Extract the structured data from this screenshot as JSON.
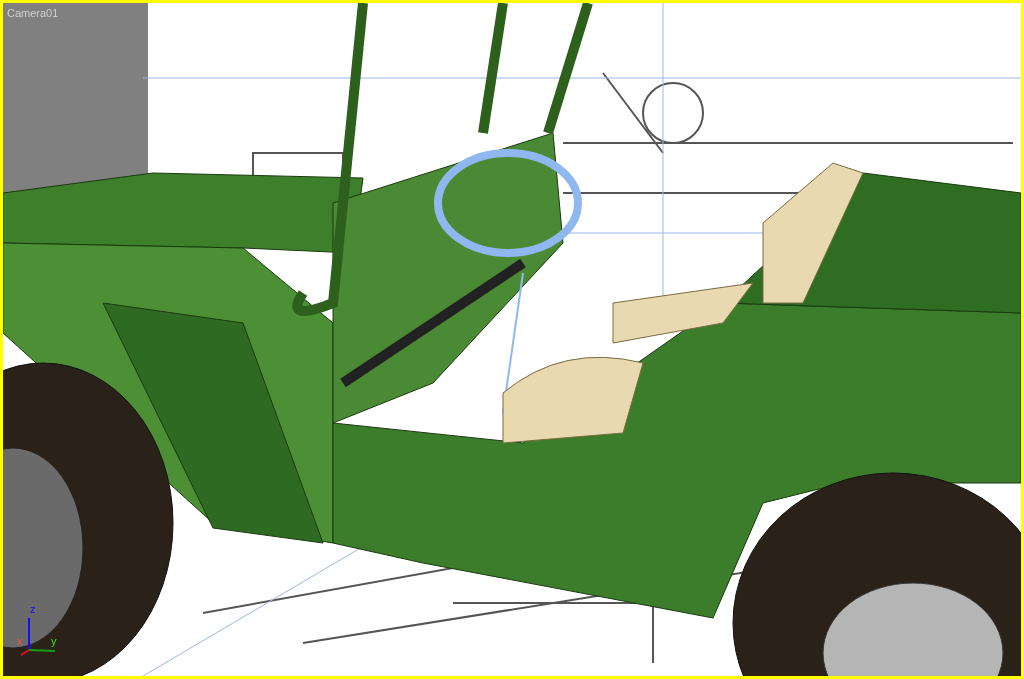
{
  "viewport": {
    "label": "Camera01",
    "active": true,
    "axis_gizmo": {
      "x": "x",
      "y": "y",
      "z": "z"
    }
  }
}
